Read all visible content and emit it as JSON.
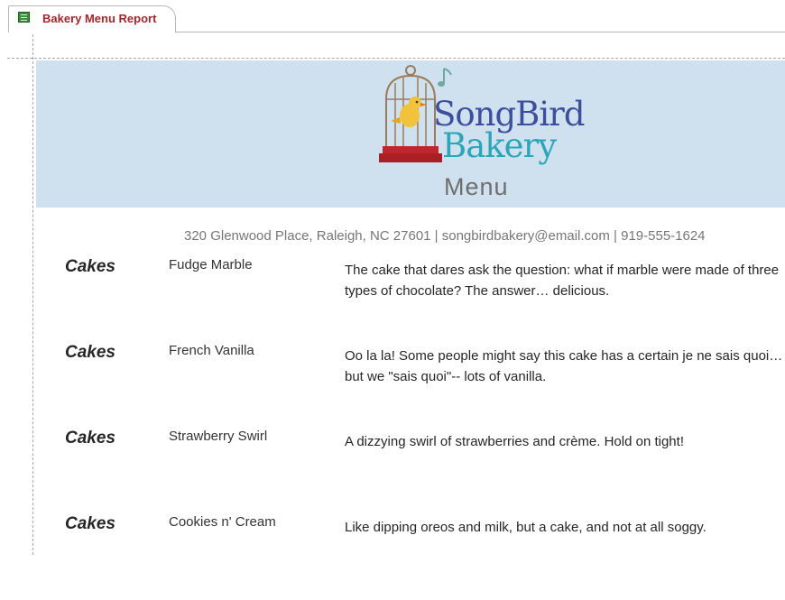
{
  "tab": {
    "label": "Bakery Menu Report",
    "icon": "report-icon"
  },
  "header": {
    "logo_line1": "SongBird",
    "logo_line2": "Bakery",
    "title": "Menu",
    "band_color": "#cfe1ee",
    "brand_colors": {
      "songbird": "#3d4f9c",
      "bakery": "#2aa6b8",
      "bird": "#f2c23a",
      "perch": "#c0262c"
    }
  },
  "contact": "320 Glenwood Place, Raleigh, NC 27601 | songbirdbakery@email.com  | 919-555-1624",
  "items": [
    {
      "category": "Cakes",
      "name": "Fudge Marble",
      "description": "The cake that dares ask the question: what if marble were made of three types of chocolate? The answer… delicious."
    },
    {
      "category": "Cakes",
      "name": "French Vanilla",
      "description": "Oo la la! Some people might say this cake has a certain je ne sais quoi… but we \"sais quoi\"-- lots of vanilla."
    },
    {
      "category": "Cakes",
      "name": "Strawberry Swirl",
      "description": "A dizzying swirl of strawberries and crème. Hold on tight!"
    },
    {
      "category": "Cakes",
      "name": "Cookies n' Cream",
      "description": "Like dipping oreos and milk, but a cake, and not at all soggy."
    }
  ]
}
